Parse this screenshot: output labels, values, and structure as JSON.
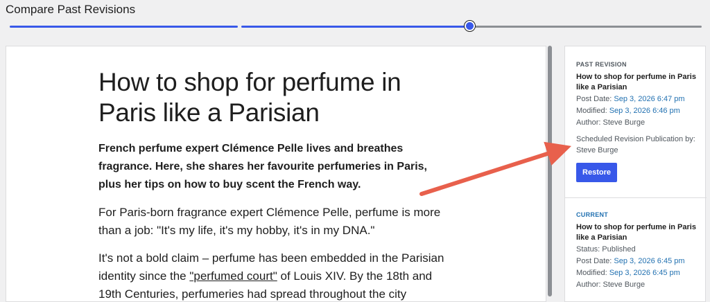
{
  "page": {
    "title": "Compare Past Revisions"
  },
  "timeline": {
    "selected_position": 0.65
  },
  "article": {
    "title": "How to shop for perfume in Paris like a Parisian",
    "lead": "French perfume expert Clémence Pelle lives and breathes fragrance. Here, she shares her favourite perfumeries in Paris, plus her tips on how to buy scent the French way.",
    "para1": "For Paris-born fragrance expert Clémence Pelle, perfume is more than a job: \"It's my life, it's my hobby, it's in my DNA.\"",
    "para2_before": "It's not a bold claim – perfume has been embedded in the Parisian identity since the ",
    "para2_link": "\"perfumed court\"",
    "para2_after": " of Louis XIV. By the 18th and 19th Centuries, perfumeries had spread throughout the city"
  },
  "past_revision": {
    "label": "PAST REVISION",
    "title": "How to shop for perfume in Paris like a Parisian",
    "post_date_label": "Post Date: ",
    "post_date": "Sep 3, 2026 6:47 pm",
    "modified_label": "Modified: ",
    "modified": "Sep 3, 2026 6:46 pm",
    "author": "Author: Steve Burge",
    "note": "Scheduled Revision Publication by: Steve Burge",
    "restore_label": "Restore"
  },
  "current": {
    "label": "CURRENT",
    "title": "How to shop for perfume in Paris like a Parisian",
    "status": "Status: Published",
    "post_date_label": "Post Date: ",
    "post_date": "Sep 3, 2026 6:45 pm",
    "modified_label": "Modified: ",
    "modified": "Sep 3, 2026 6:45 pm",
    "author": "Author: Steve Burge"
  },
  "colors": {
    "accent": "#3858e9",
    "link": "#2271b1",
    "arrow": "#e8604c"
  }
}
